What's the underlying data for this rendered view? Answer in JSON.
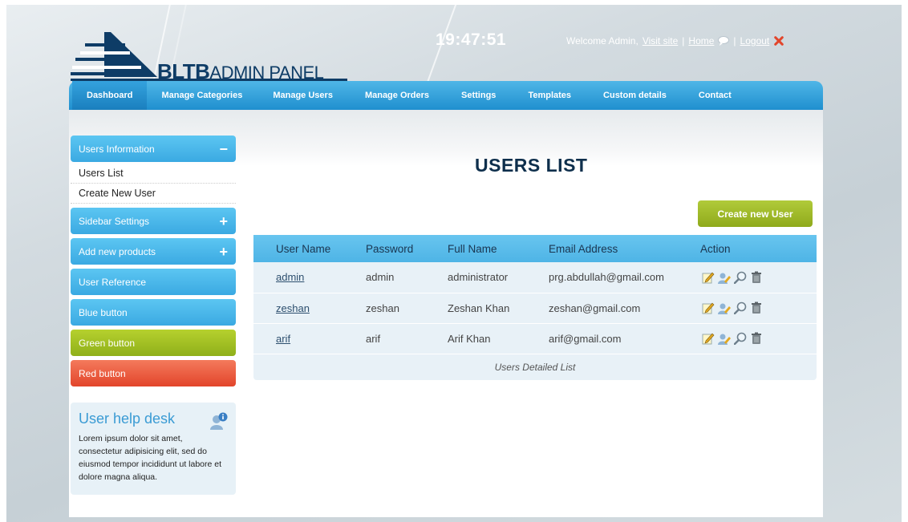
{
  "brand": {
    "logo_prefix": "BLTB",
    "logo_suffix": "ADMIN PANEL"
  },
  "clock": "19:47:51",
  "topnav": {
    "welcome": "Welcome Admin,",
    "visit_site": "Visit site",
    "sep1": "|",
    "home": "Home",
    "sep2": "|",
    "logout": "Logout"
  },
  "menu": [
    {
      "label": "Dashboard"
    },
    {
      "label": "Manage Categories"
    },
    {
      "label": "Manage Users"
    },
    {
      "label": "Manage Orders"
    },
    {
      "label": "Settings"
    },
    {
      "label": "Templates"
    },
    {
      "label": "Custom details"
    },
    {
      "label": "Contact"
    }
  ],
  "sidebar": {
    "users_info": {
      "label": "Users Information",
      "sign": "−"
    },
    "users_list": "Users List",
    "create_new_user": "Create New User",
    "sidebar_settings": {
      "label": "Sidebar Settings",
      "sign": "+"
    },
    "add_products": {
      "label": "Add new products",
      "sign": "+"
    },
    "user_reference": "User Reference",
    "blue_button": "Blue button",
    "green_button": "Green button",
    "red_button": "Red button"
  },
  "helpdesk": {
    "title": "User help desk",
    "text": "Lorem ipsum dolor sit amet, consectetur adipisicing elit, sed do eiusmod tempor incididunt ut labore et dolore magna aliqua."
  },
  "main": {
    "title": "USERS LIST",
    "create_button": "Create new User",
    "columns": [
      "User Name",
      "Password",
      "Full Name",
      "Email Address",
      "Action"
    ],
    "rows": [
      {
        "username": "admin",
        "password": "admin",
        "fullname": "administrator",
        "email": "prg.abdullah@gmail.com"
      },
      {
        "username": "zeshan",
        "password": "zeshan",
        "fullname": "Zeshan Khan",
        "email": "zeshan@gmail.com"
      },
      {
        "username": "arif",
        "password": "arif",
        "fullname": "Arif Khan",
        "email": "arif@gmail.com"
      }
    ],
    "footer": "Users Detailed List",
    "action_icons": [
      "edit-icon",
      "user-edit-icon",
      "search-icon",
      "trash-icon"
    ]
  },
  "colors": {
    "menu_blue": "#1f8fcf",
    "sidebar_blue": "#3aa9e2",
    "green": "#8fb01a",
    "red": "#e2452b",
    "navy": "#0e3c66"
  }
}
